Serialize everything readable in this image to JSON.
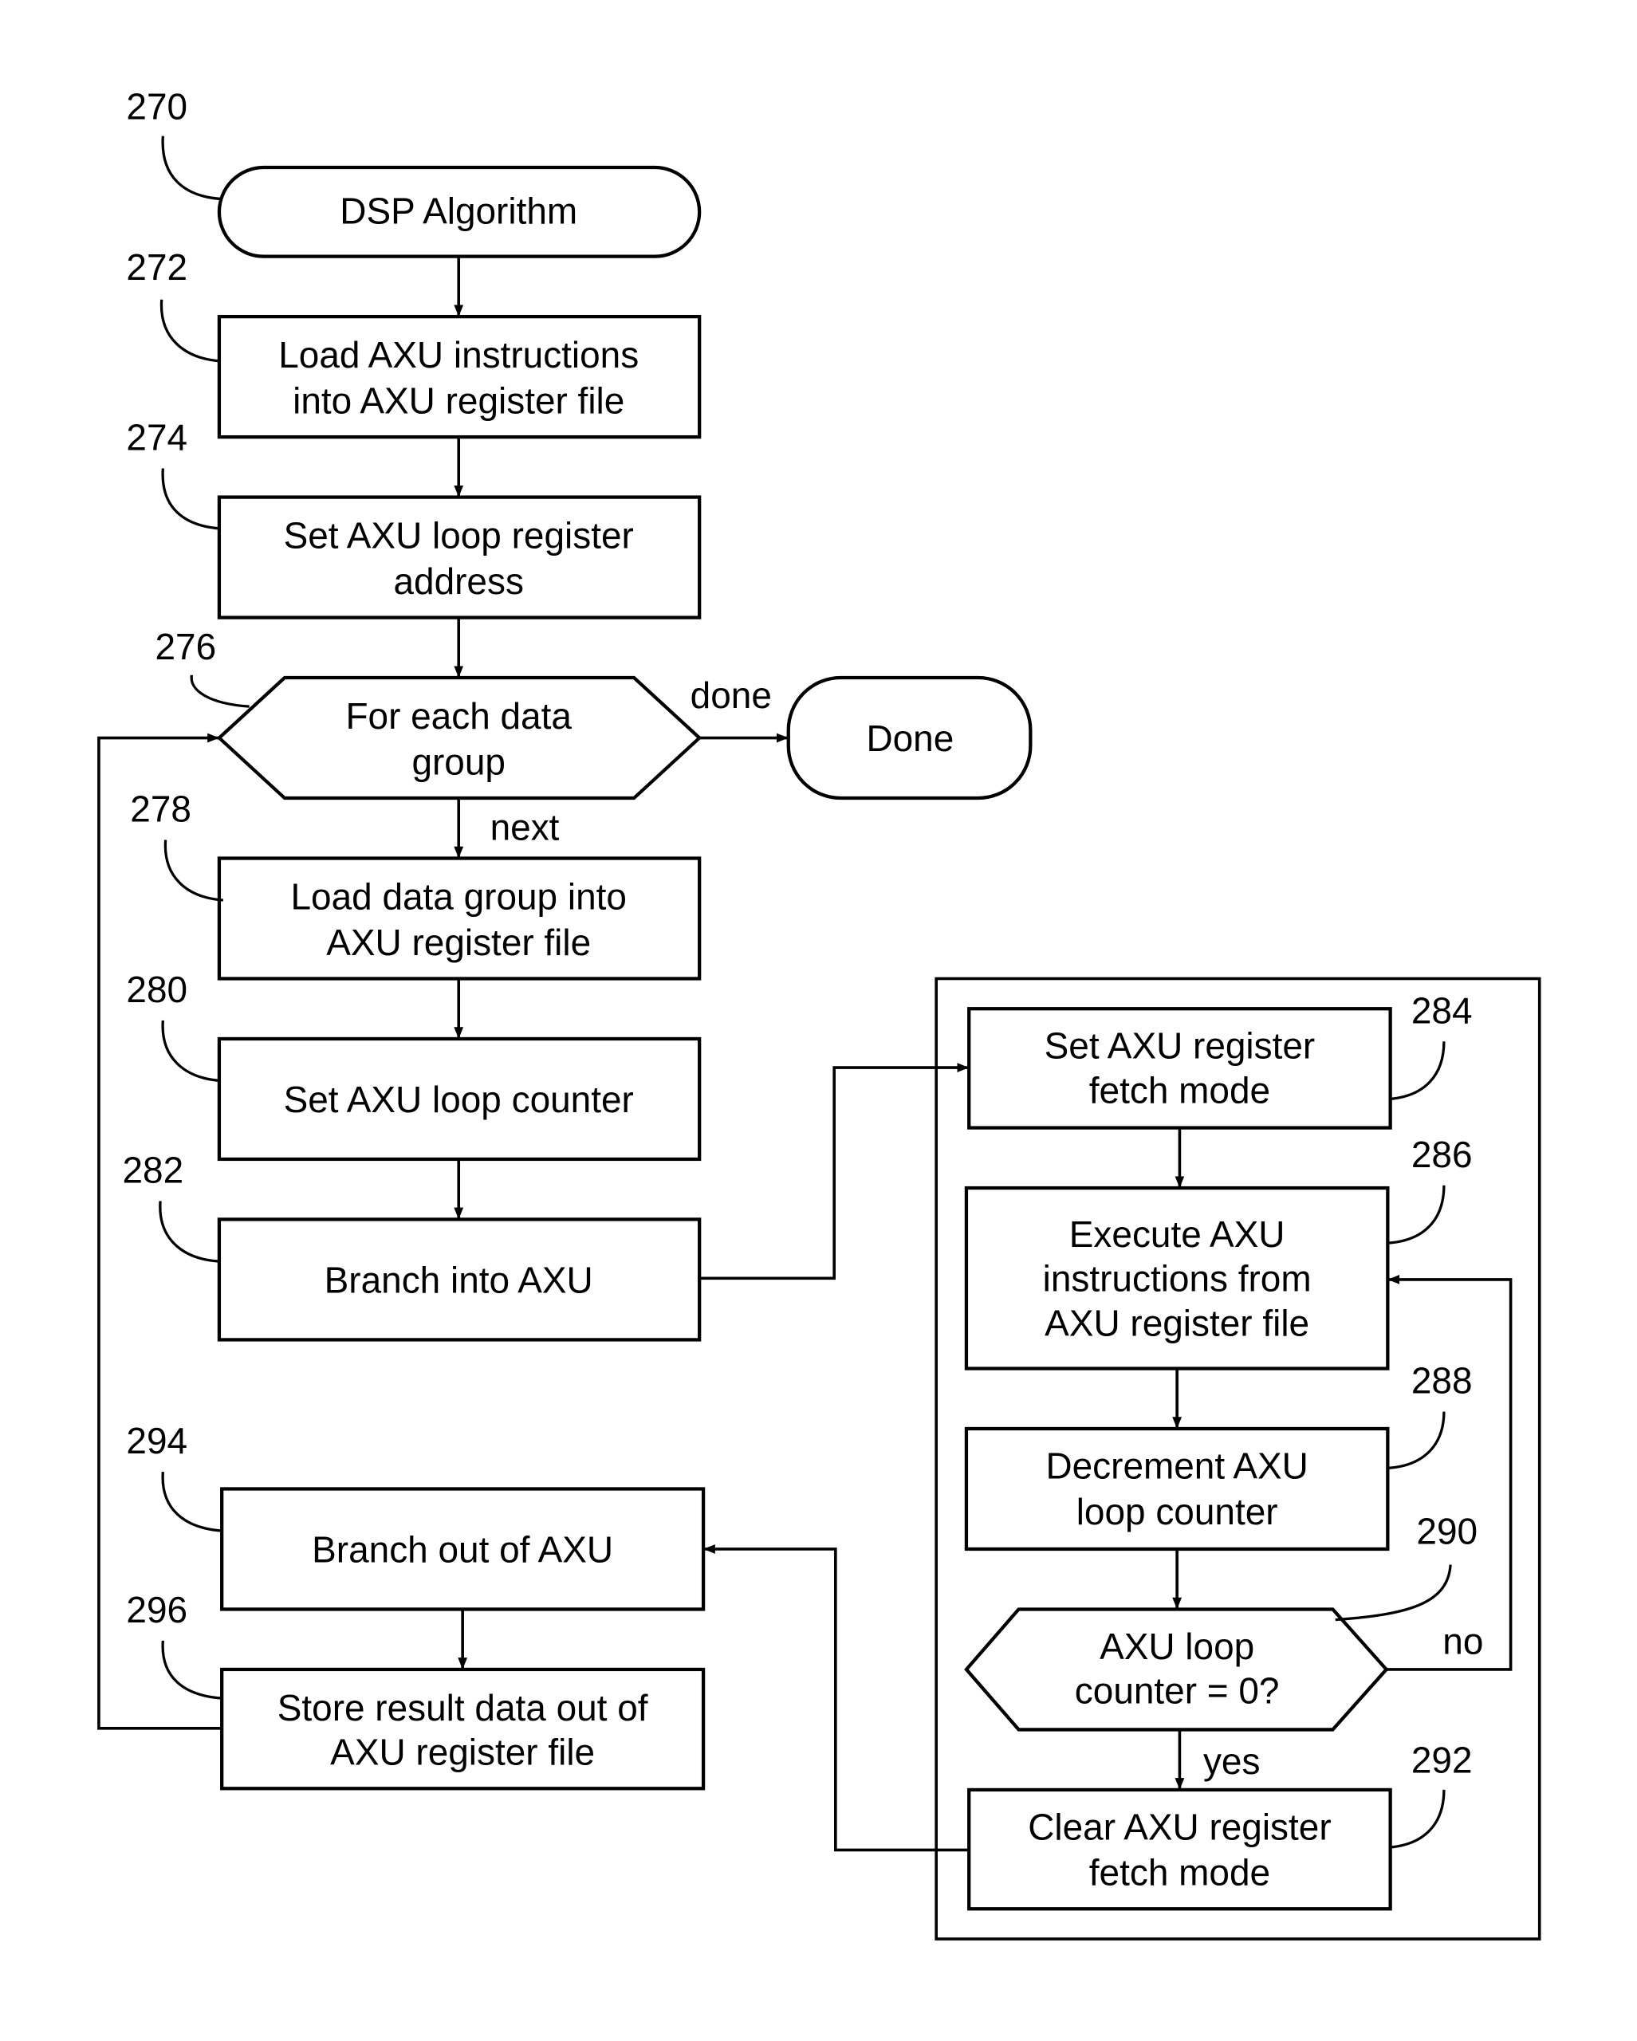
{
  "figure": {
    "nodes": {
      "n270": {
        "ref": "270",
        "lines": [
          "DSP Algorithm"
        ]
      },
      "n272": {
        "ref": "272",
        "lines": [
          "Load AXU instructions",
          "into AXU register file"
        ]
      },
      "n274": {
        "ref": "274",
        "lines": [
          "Set AXU loop register",
          "address"
        ]
      },
      "n276": {
        "ref": "276",
        "lines": [
          "For each data",
          "group"
        ]
      },
      "done": {
        "lines": [
          "Done"
        ]
      },
      "n278": {
        "ref": "278",
        "lines": [
          "Load data group into",
          "AXU register file"
        ]
      },
      "n280": {
        "ref": "280",
        "lines": [
          "Set AXU loop counter"
        ]
      },
      "n282": {
        "ref": "282",
        "lines": [
          "Branch into AXU"
        ]
      },
      "n284": {
        "ref": "284",
        "lines": [
          "Set AXU register",
          "fetch mode"
        ]
      },
      "n286": {
        "ref": "286",
        "lines": [
          "Execute AXU",
          "instructions from",
          "AXU register file"
        ]
      },
      "n288": {
        "ref": "288",
        "lines": [
          "Decrement AXU",
          "loop counter"
        ]
      },
      "n290": {
        "ref": "290",
        "lines": [
          "AXU loop",
          "counter = 0?"
        ]
      },
      "n292": {
        "ref": "292",
        "lines": [
          "Clear AXU register",
          "fetch mode"
        ]
      },
      "n294": {
        "ref": "294",
        "lines": [
          "Branch out of AXU"
        ]
      },
      "n296": {
        "ref": "296",
        "lines": [
          "Store result data out of",
          "AXU register file"
        ]
      }
    },
    "edge_labels": {
      "done": "done",
      "next": "next",
      "no": "no",
      "yes": "yes"
    }
  }
}
